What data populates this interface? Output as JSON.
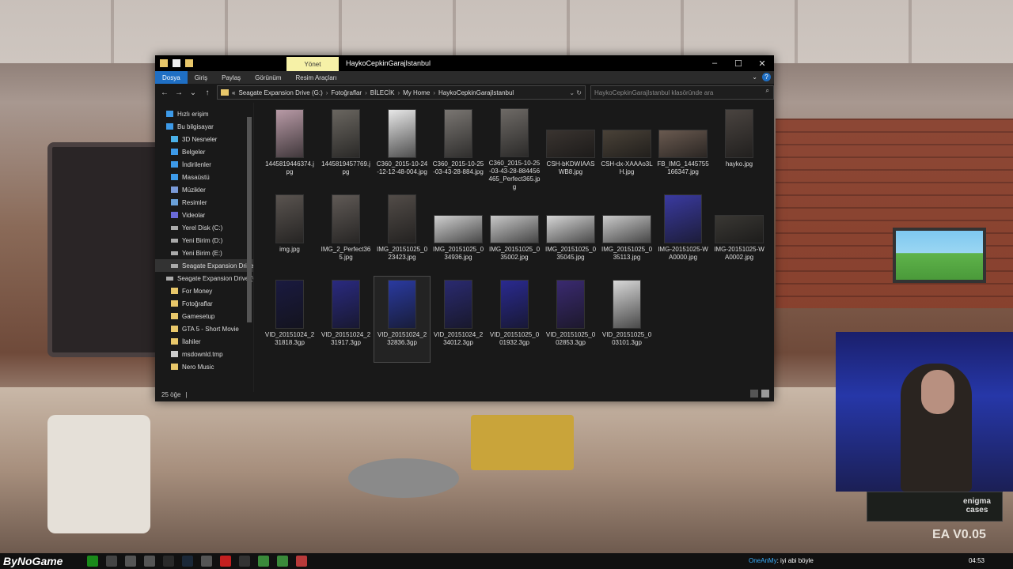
{
  "window": {
    "title": "HaykoCepkinGarajIstanbul",
    "manage_tab": "Yönet",
    "controls": {
      "minimize": "–",
      "maximize": "☐",
      "close": "✕"
    }
  },
  "ribbon": {
    "tabs": [
      "Dosya",
      "Giriş",
      "Paylaş",
      "Görünüm",
      "Resim Araçları"
    ]
  },
  "address": {
    "prefix": "«",
    "crumbs": [
      "Seagate Expansion Drive (G:)",
      "Fotoğraflar",
      "BİLECİK",
      "My Home",
      "HaykoCepkinGarajIstanbul"
    ],
    "search_placeholder": "HaykoCepkinGarajIstanbul klasöründe ara"
  },
  "nav": {
    "items": [
      {
        "label": "Hızlı erişim",
        "icon": "star-icon",
        "indent": 1
      },
      {
        "label": "Bu bilgisayar",
        "icon": "computer-icon",
        "indent": 1
      },
      {
        "label": "3D Nesneler",
        "icon": "cube-icon",
        "indent": 2
      },
      {
        "label": "Belgeler",
        "icon": "documents-icon",
        "indent": 2
      },
      {
        "label": "İndirilenler",
        "icon": "download-icon",
        "indent": 2
      },
      {
        "label": "Masaüstü",
        "icon": "desktop-icon",
        "indent": 2
      },
      {
        "label": "Müzikler",
        "icon": "music-icon",
        "indent": 2
      },
      {
        "label": "Resimler",
        "icon": "pictures-icon",
        "indent": 2
      },
      {
        "label": "Videolar",
        "icon": "videos-icon",
        "indent": 2
      },
      {
        "label": "Yerel Disk (C:)",
        "icon": "drive-icon",
        "indent": 2
      },
      {
        "label": "Yeni Birim (D:)",
        "icon": "drive-icon",
        "indent": 2
      },
      {
        "label": "Yeni Birim (E:)",
        "icon": "drive-icon",
        "indent": 2
      },
      {
        "label": "Seagate Expansion Drive (",
        "icon": "drive-icon",
        "indent": 2,
        "selected": true
      },
      {
        "label": "Seagate Expansion Drive (G",
        "icon": "drive-icon",
        "indent": 1
      },
      {
        "label": "For Money",
        "icon": "folder-icon",
        "indent": 2
      },
      {
        "label": "Fotoğraflar",
        "icon": "folder-icon",
        "indent": 2
      },
      {
        "label": "Gamesetup",
        "icon": "folder-icon",
        "indent": 2
      },
      {
        "label": "GTA 5 - Short Movie",
        "icon": "folder-icon",
        "indent": 2
      },
      {
        "label": "İlahiler",
        "icon": "folder-icon",
        "indent": 2
      },
      {
        "label": "msdownld.tmp",
        "icon": "file-icon",
        "indent": 2
      },
      {
        "label": "Nero Music",
        "icon": "folder-icon",
        "indent": 2
      }
    ]
  },
  "files": [
    {
      "name": "1445819446374.jpg",
      "shape": "portrait",
      "tone": "#b89aa6"
    },
    {
      "name": "1445819457769.jpg",
      "shape": "portrait",
      "tone": "#6a6660"
    },
    {
      "name": "C360_2015-10-24-12-12-48-004.jpg",
      "shape": "portrait",
      "tone": "#e8e8e8"
    },
    {
      "name": "C360_2015-10-25-03-43-28-884.jpg",
      "shape": "portrait",
      "tone": "#7a7672"
    },
    {
      "name": "C360_2015-10-25-03-43-28-884456465_Perfect365.jpg",
      "shape": "portrait",
      "tone": "#6e6a66"
    },
    {
      "name": "CSH-bKDWIAASWB8.jpg",
      "shape": "wide",
      "tone": "#3a3430"
    },
    {
      "name": "CSH-dx-XAAAo3LH.jpg",
      "shape": "wide",
      "tone": "#4a4238"
    },
    {
      "name": "FB_IMG_1445755166347.jpg",
      "shape": "wide",
      "tone": "#6a5a50"
    },
    {
      "name": "hayko.jpg",
      "shape": "portrait",
      "tone": "#4a4440"
    },
    {
      "name": "img.jpg",
      "shape": "portrait",
      "tone": "#5a5450"
    },
    {
      "name": "IMG_2_Perfect365.jpg",
      "shape": "portrait",
      "tone": "#605a56"
    },
    {
      "name": "IMG_20151025_023423.jpg",
      "shape": "portrait",
      "tone": "#524c48"
    },
    {
      "name": "IMG_20151025_034936.jpg",
      "shape": "wide",
      "tone": "#d0d0d0"
    },
    {
      "name": "IMG_20151025_035002.jpg",
      "shape": "wide",
      "tone": "#c8c8c8"
    },
    {
      "name": "IMG_20151025_035045.jpg",
      "shape": "wide",
      "tone": "#d6d6d6"
    },
    {
      "name": "IMG_20151025_035113.jpg",
      "shape": "wide",
      "tone": "#cacaca"
    },
    {
      "name": "IMG-20151025-WA0000.jpg",
      "shape": "portrait-wide",
      "tone": "#3a3aa0"
    },
    {
      "name": "IMG-20151025-WA0002.jpg",
      "shape": "wide",
      "tone": "#3a3834"
    },
    {
      "name": "VID_20151024_231818.3gp",
      "shape": "portrait",
      "tone": "#1a1a40"
    },
    {
      "name": "VID_20151024_231917.3gp",
      "shape": "portrait",
      "tone": "#2a2a80"
    },
    {
      "name": "VID_20151024_232836.3gp",
      "shape": "portrait",
      "tone": "#2a3aa0",
      "selected": true
    },
    {
      "name": "VID_20151024_234012.3gp",
      "shape": "portrait",
      "tone": "#2a2a70"
    },
    {
      "name": "VID_20151025_001932.3gp",
      "shape": "portrait",
      "tone": "#2a2a90"
    },
    {
      "name": "VID_20151025_002853.3gp",
      "shape": "portrait",
      "tone": "#3a2a70"
    },
    {
      "name": "VID_20151025_003101.3gp",
      "shape": "portrait",
      "tone": "#d8d8d8"
    }
  ],
  "status": {
    "count": "25 öğe",
    "divider": "|"
  },
  "overlay": {
    "brand": "ByNoGame",
    "version": "EA V0.05",
    "enigma_logo": "enigma\ncases"
  },
  "taskbar": {
    "chat_user": "OneAnMy",
    "chat_message": "iyi abi böyle",
    "clock": "04:53"
  }
}
